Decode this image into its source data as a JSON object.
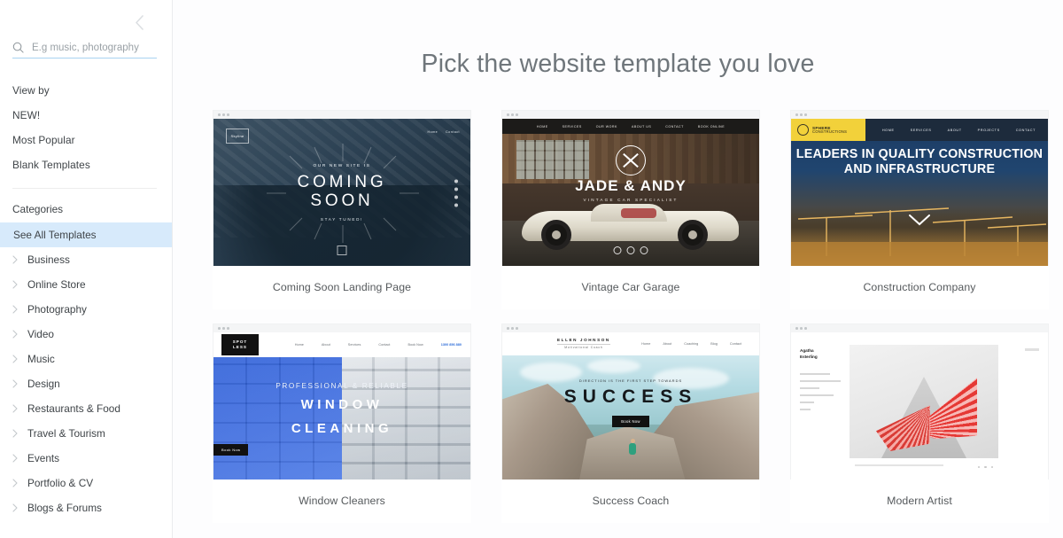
{
  "sidebar": {
    "collapse_icon": "chevron-left-icon",
    "search": {
      "icon": "search-icon",
      "placeholder": "E.g music, photography",
      "value": ""
    },
    "view_by_label": "View by",
    "view_by_items": [
      {
        "label": "NEW!"
      },
      {
        "label": "Most Popular"
      },
      {
        "label": "Blank Templates"
      }
    ],
    "categories_label": "Categories",
    "see_all_label": "See All Templates",
    "categories": [
      {
        "label": "Business",
        "icon": "chevron-right-icon"
      },
      {
        "label": "Online Store",
        "icon": "chevron-right-icon"
      },
      {
        "label": "Photography",
        "icon": "chevron-right-icon"
      },
      {
        "label": "Video",
        "icon": "chevron-right-icon"
      },
      {
        "label": "Music",
        "icon": "chevron-right-icon"
      },
      {
        "label": "Design",
        "icon": "chevron-right-icon"
      },
      {
        "label": "Restaurants & Food",
        "icon": "chevron-right-icon"
      },
      {
        "label": "Travel & Tourism",
        "icon": "chevron-right-icon"
      },
      {
        "label": "Events",
        "icon": "chevron-right-icon"
      },
      {
        "label": "Portfolio & CV",
        "icon": "chevron-right-icon"
      },
      {
        "label": "Blogs & Forums",
        "icon": "chevron-right-icon"
      }
    ],
    "highlight_color": "#d7eafb",
    "search_underline_color": "#a8d2f0"
  },
  "main": {
    "title": "Pick the website template you love"
  },
  "templates": [
    {
      "name": "Coming Soon Landing Page",
      "preview": {
        "logo": "Skyline",
        "nav": [
          "Home",
          "Contact"
        ],
        "kicker": "OUR NEW SITE IS",
        "headline_line1": "COMING",
        "headline_line2": "SOON",
        "subtext": "STAY TUNED!"
      }
    },
    {
      "name": "Vintage Car Garage",
      "preview": {
        "nav": [
          "HOME",
          "SERVICES",
          "OUR WORK",
          "ABOUT US",
          "CONTACT",
          "BOOK ONLINE"
        ],
        "headline": "JADE & ANDY",
        "subtext": "VINTAGE CAR SPECIALIST"
      }
    },
    {
      "name": "Construction Company",
      "preview": {
        "logo_line1": "SPHERE",
        "logo_line2": "CONSTRUCTIONS",
        "logo_bg": "#f2d13a",
        "nav": [
          "HOME",
          "SERVICES",
          "ABOUT",
          "PROJECTS",
          "CONTACT"
        ],
        "headline": "LEADERS IN QUALITY CONSTRUCTION AND INFRASTRUCTURE",
        "scroll_icon": "chevron-down-icon"
      }
    },
    {
      "name": "Window Cleaners",
      "preview": {
        "logo_line1": "SPOT",
        "logo_line2": "LESS",
        "nav": [
          "Home",
          "About",
          "Services",
          "Contact",
          "Book Now"
        ],
        "phone": "1300 856 880",
        "kicker": "PROFESSIONAL & RELIABLE",
        "headline_line1": "WINDOW",
        "headline_line2": "CLEANING",
        "button": "Book Now"
      }
    },
    {
      "name": "Success Coach",
      "preview": {
        "brand": "ELLEN JOHNSON",
        "brand_sub": "Motivational Coach",
        "nav": [
          "Home",
          "About",
          "Coaching",
          "Blog",
          "Contact"
        ],
        "kicker": "DIRECTION IS THE FIRST STEP TOWARDS",
        "headline": "SUCCESS",
        "button": "Book Now"
      }
    },
    {
      "name": "Modern Artist",
      "preview": {
        "brand_line1": "Agatha",
        "brand_line2": "Esterling"
      }
    }
  ]
}
